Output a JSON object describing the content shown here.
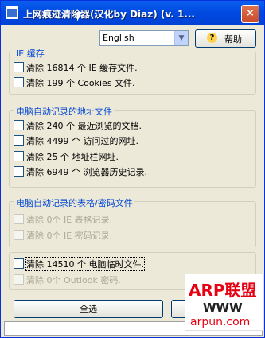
{
  "window": {
    "title": "上网痕迹清除器(汉化by Diaz)  (v. 1...",
    "close": "×"
  },
  "language": {
    "selected": "English"
  },
  "help": {
    "label": "帮助",
    "icon": "?"
  },
  "groups": [
    {
      "title": "IE 缓存",
      "items": [
        {
          "label": "清除 16814 个 IE 缓存文件.",
          "enabled": true
        },
        {
          "label": "清除 199 个 Cookies 文件.",
          "enabled": true
        }
      ]
    },
    {
      "title": "电脑自动记录的地址文件",
      "items": [
        {
          "label": "清除 240 个 最近浏览的文档.",
          "enabled": true
        },
        {
          "label": "清除 4499 个 访问过的网址.",
          "enabled": true
        },
        {
          "label": "清除 25 个 地址栏网址.",
          "enabled": true
        },
        {
          "label": "清除 6949 个 浏览器历史记录.",
          "enabled": true
        }
      ]
    },
    {
      "title": "电脑自动记录的表格/密码文件",
      "items": [
        {
          "label": "清除 0个 IE 表格记录.",
          "enabled": false
        },
        {
          "label": "清除 0个 IE 密码记录.",
          "enabled": false
        }
      ]
    },
    {
      "title": "",
      "items": [
        {
          "label": "清除 14510 个 电脑临时文件.",
          "enabled": true
        },
        {
          "label": "清除 0个 Outlook 密码.",
          "enabled": false
        }
      ]
    }
  ],
  "buttons": {
    "select_all": "全选",
    "second": "立"
  },
  "watermark": {
    "brand": "ARP联盟",
    "www": "WWW",
    "url": "arpun.com"
  }
}
